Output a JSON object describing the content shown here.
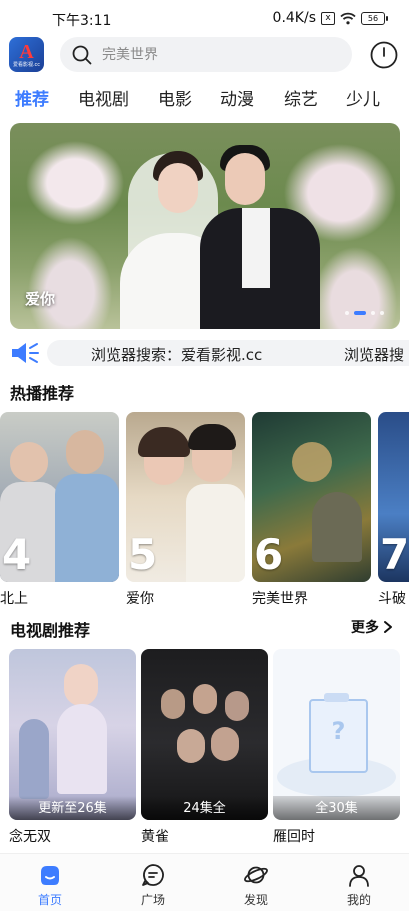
{
  "status_bar": {
    "time": "下午3:11",
    "network_speed": "0.4K/s",
    "sim_icon_label": "x",
    "battery": "56"
  },
  "header": {
    "logo_letter": "A",
    "logo_subtext": "爱看影视.cc",
    "search_placeholder": "完美世界",
    "history_icon": "clock-icon"
  },
  "tabs": [
    {
      "label": "推荐",
      "active": true
    },
    {
      "label": "电视剧",
      "active": false
    },
    {
      "label": "电影",
      "active": false
    },
    {
      "label": "动漫",
      "active": false
    },
    {
      "label": "综艺",
      "active": false
    },
    {
      "label": "少儿",
      "active": false
    }
  ],
  "banner": {
    "title": "爱你",
    "active_dot": 1,
    "dot_count": 4
  },
  "notice": {
    "text": "浏览器搜索：爱看影视.cc",
    "text_repeat": "浏览器搜"
  },
  "hot": {
    "title": "热播推荐",
    "items": [
      {
        "rank": "4",
        "title": "北上"
      },
      {
        "rank": "5",
        "title": "爱你"
      },
      {
        "rank": "6",
        "title": "完美世界"
      },
      {
        "rank": "7",
        "title": "斗破"
      }
    ]
  },
  "tv": {
    "title": "电视剧推荐",
    "more_label": "更多",
    "items": [
      {
        "title": "念无双",
        "badge": "更新至26集"
      },
      {
        "title": "黄雀",
        "badge": "24集全"
      },
      {
        "title": "雁回时",
        "badge": "全30集"
      }
    ]
  },
  "bottom_nav": [
    {
      "label": "首页",
      "icon": "home-icon",
      "active": true
    },
    {
      "label": "广场",
      "icon": "chat-icon",
      "active": false
    },
    {
      "label": "发现",
      "icon": "planet-icon",
      "active": false
    },
    {
      "label": "我的",
      "icon": "profile-icon",
      "active": false
    }
  ],
  "colors": {
    "accent": "#3d7cff",
    "text": "#111111",
    "search_bg": "#f1f2f4"
  }
}
